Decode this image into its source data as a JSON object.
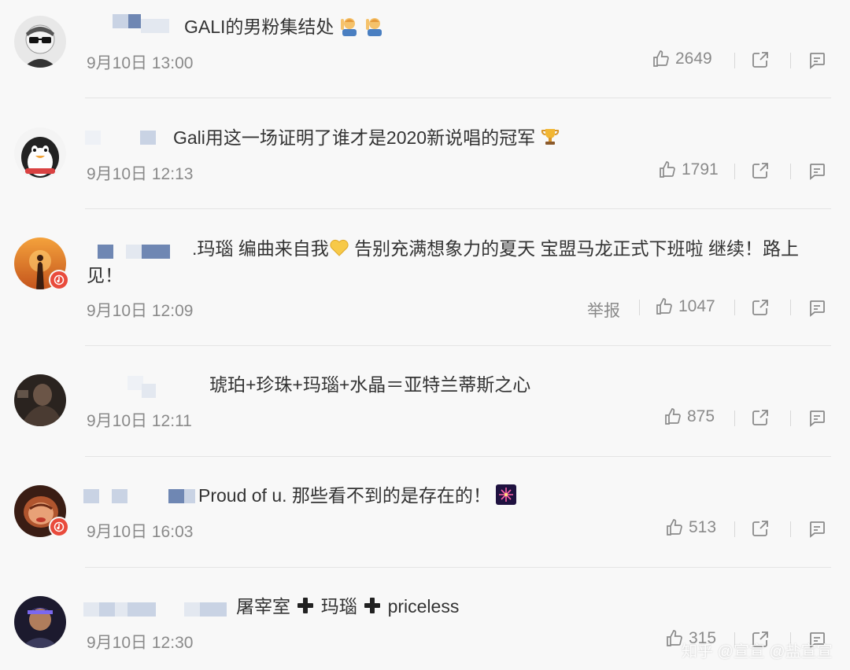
{
  "comments": [
    {
      "text": "GALI的男粉集结处",
      "time": "9月10日 13:00",
      "likes": "2649"
    },
    {
      "text": "Gali用这一场证明了谁才是2020新说唱的冠军",
      "time": "9月10日 12:13",
      "likes": "1791"
    },
    {
      "text": ".玛瑙 编曲来自我",
      "text2": " 告别充满想象力的夏天 宝盟马龙正式下班啦 继续！路上见！",
      "time": "9月10日 12:09",
      "report": "举报",
      "likes": "1047"
    },
    {
      "text": "琥珀+珍珠+玛瑙+水晶＝亚特兰蒂斯之心",
      "time": "9月10日 12:11",
      "likes": "875"
    },
    {
      "text": "Proud of u. 那些看不到的是存在的！",
      "time": "9月10日 16:03",
      "likes": "513"
    },
    {
      "text": "屠宰室",
      "text2": "玛瑙",
      "text3": "priceless",
      "time": "9月10日 12:30",
      "likes": "315"
    }
  ],
  "icons": {
    "like": "thumbs-up-icon",
    "share": "share-icon",
    "reply": "comment-icon",
    "badge": "music-note-icon"
  },
  "colors": {
    "background": "#f8f8f8",
    "text": "#333333",
    "meta": "#8a8a8a",
    "badge": "#e94b3c"
  },
  "watermark": "知乎 @宣宣 @盐宣宣"
}
